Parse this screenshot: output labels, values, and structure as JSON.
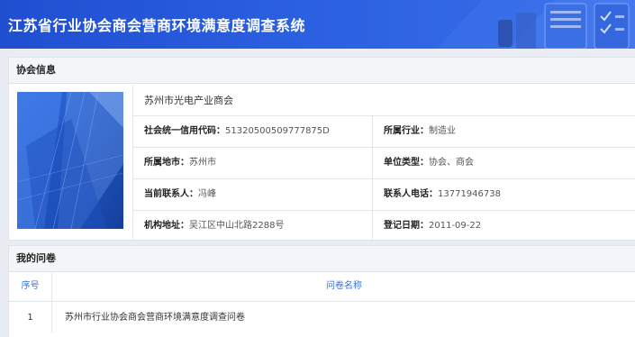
{
  "header": {
    "title": "江苏省行业协会商会营商环境满意度调查系统"
  },
  "colors": {
    "header_blue": "#2a5fe0",
    "link_blue": "#3a6fd8",
    "panel_bg": "#f3f5f8"
  },
  "association_panel": {
    "title": "协会信息",
    "org_name": "苏州市光电产业商会",
    "rows": [
      [
        {
          "label": "社会统一信用代码：",
          "value": "51320500509777875D"
        },
        {
          "label": "所属行业：",
          "value": "制造业"
        }
      ],
      [
        {
          "label": "所属地市：",
          "value": "苏州市"
        },
        {
          "label": "单位类型：",
          "value": "协会、商会"
        }
      ],
      [
        {
          "label": "当前联系人：",
          "value": "冯峰"
        },
        {
          "label": "联系人电话：",
          "value": "13771946738"
        }
      ],
      [
        {
          "label": "机构地址：",
          "value": "吴江区中山北路2288号"
        },
        {
          "label": "登记日期：",
          "value": "2011-09-22"
        }
      ]
    ]
  },
  "questionnaire_panel": {
    "title": "我的问卷",
    "columns": [
      "序号",
      "问卷名称"
    ],
    "rows": [
      {
        "index": "1",
        "name": "苏州市行业协会商会营商环境满意度调查问卷"
      }
    ]
  }
}
